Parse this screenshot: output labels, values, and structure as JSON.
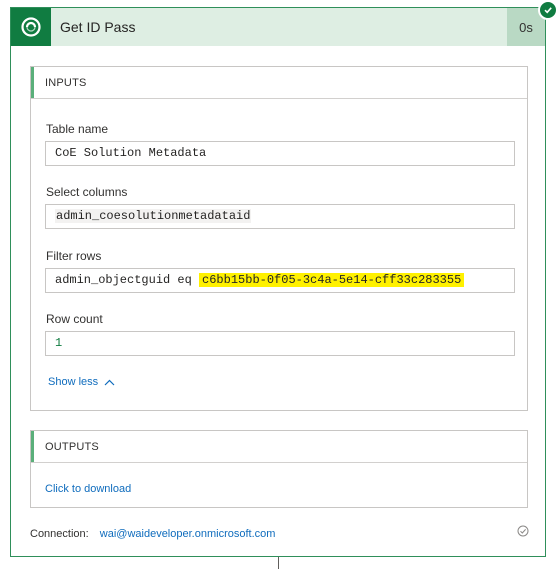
{
  "header": {
    "title": "Get ID Pass",
    "duration": "0s",
    "icon": "dataverse-icon",
    "accent_color": "#107c41"
  },
  "inputs": {
    "section_title": "INPUTS",
    "table_name": {
      "label": "Table name",
      "value": "CoE Solution Metadata"
    },
    "select_columns": {
      "label": "Select columns",
      "value": "admin_coesolutionmetadataid"
    },
    "filter_rows": {
      "label": "Filter rows",
      "prefix": "admin_objectguid eq",
      "guid": "c6bb15bb-0f05-3c4a-5e14-cff33c283355"
    },
    "row_count": {
      "label": "Row count",
      "value": "1"
    },
    "show_less": "Show less"
  },
  "outputs": {
    "section_title": "OUTPUTS",
    "download_link": "Click to download"
  },
  "connection": {
    "label": "Connection:",
    "account": "wai@waideveloper.onmicrosoft.com"
  }
}
